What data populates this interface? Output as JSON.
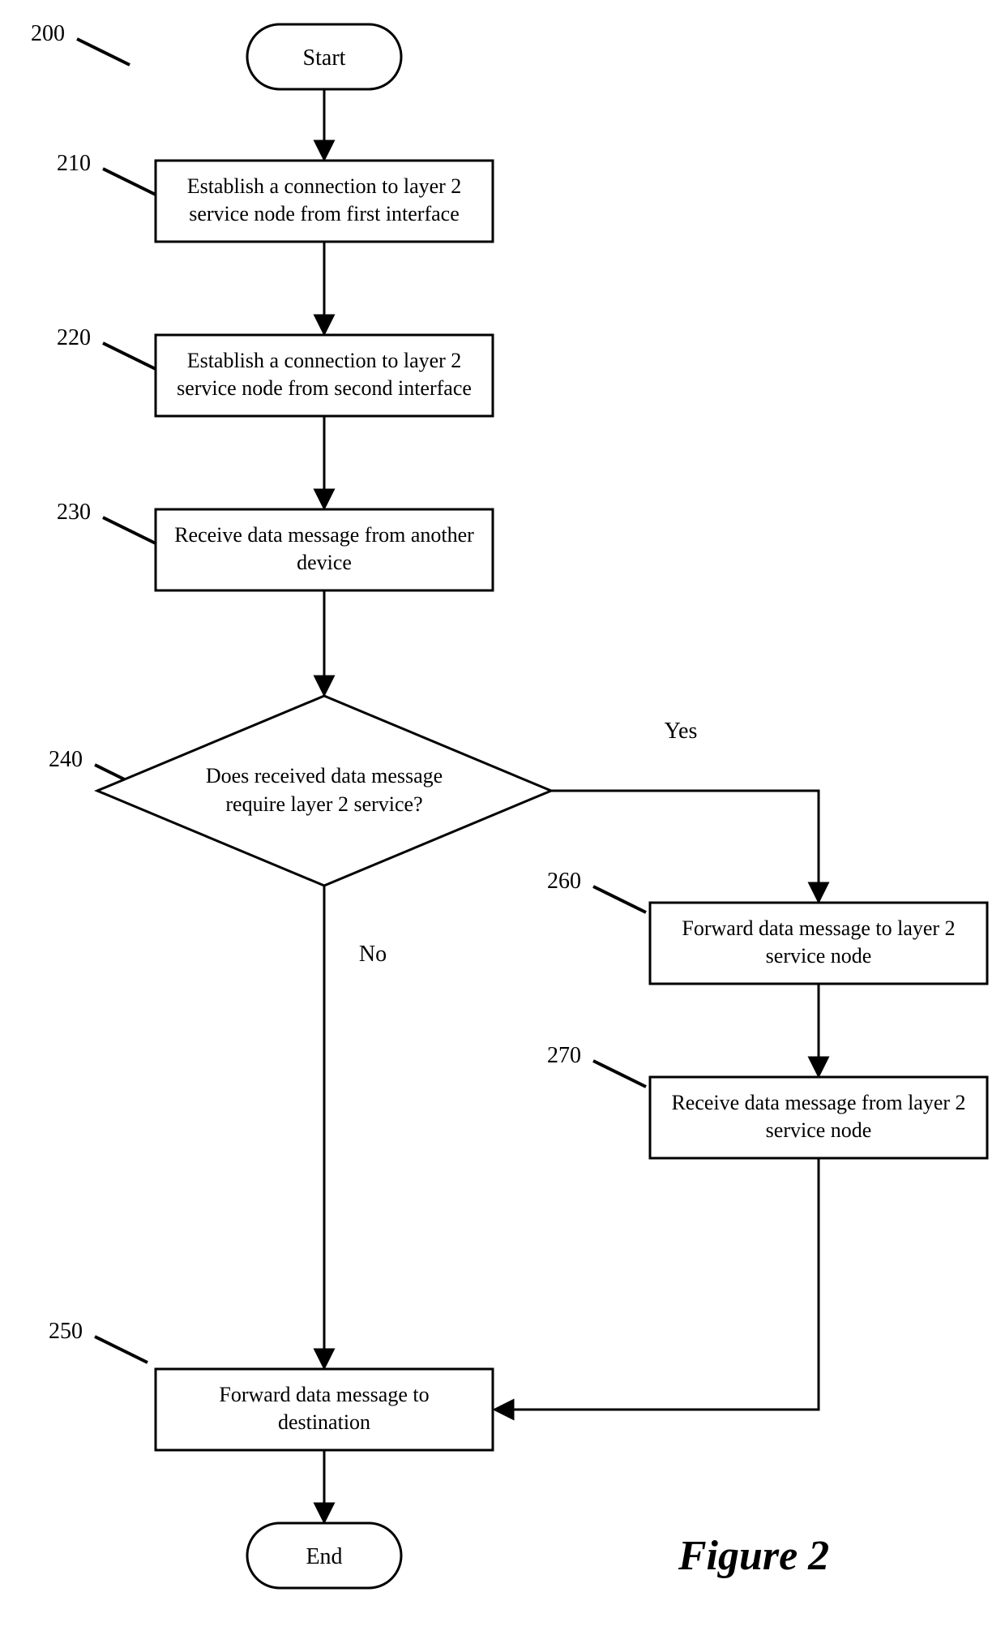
{
  "figure_label": "Figure 2",
  "refs": {
    "r200": "200",
    "r210": "210",
    "r220": "220",
    "r230": "230",
    "r240": "240",
    "r250": "250",
    "r260": "260",
    "r270": "270"
  },
  "nodes": {
    "start": "Start",
    "end": "End",
    "b210_l1": "Establish a connection to layer 2",
    "b210_l2": "service node from first interface",
    "b220_l1": "Establish a connection to layer 2",
    "b220_l2": "service node from second interface",
    "b230_l1": "Receive data message from another",
    "b230_l2": "device",
    "d240_l1": "Does received data message",
    "d240_l2": "require layer 2 service?",
    "b250_l1": "Forward data message to",
    "b250_l2": "destination",
    "b260_l1": "Forward data message to layer 2",
    "b260_l2": "service node",
    "b270_l1": "Receive data message from layer 2",
    "b270_l2": "service node"
  },
  "branches": {
    "yes": "Yes",
    "no": "No"
  }
}
